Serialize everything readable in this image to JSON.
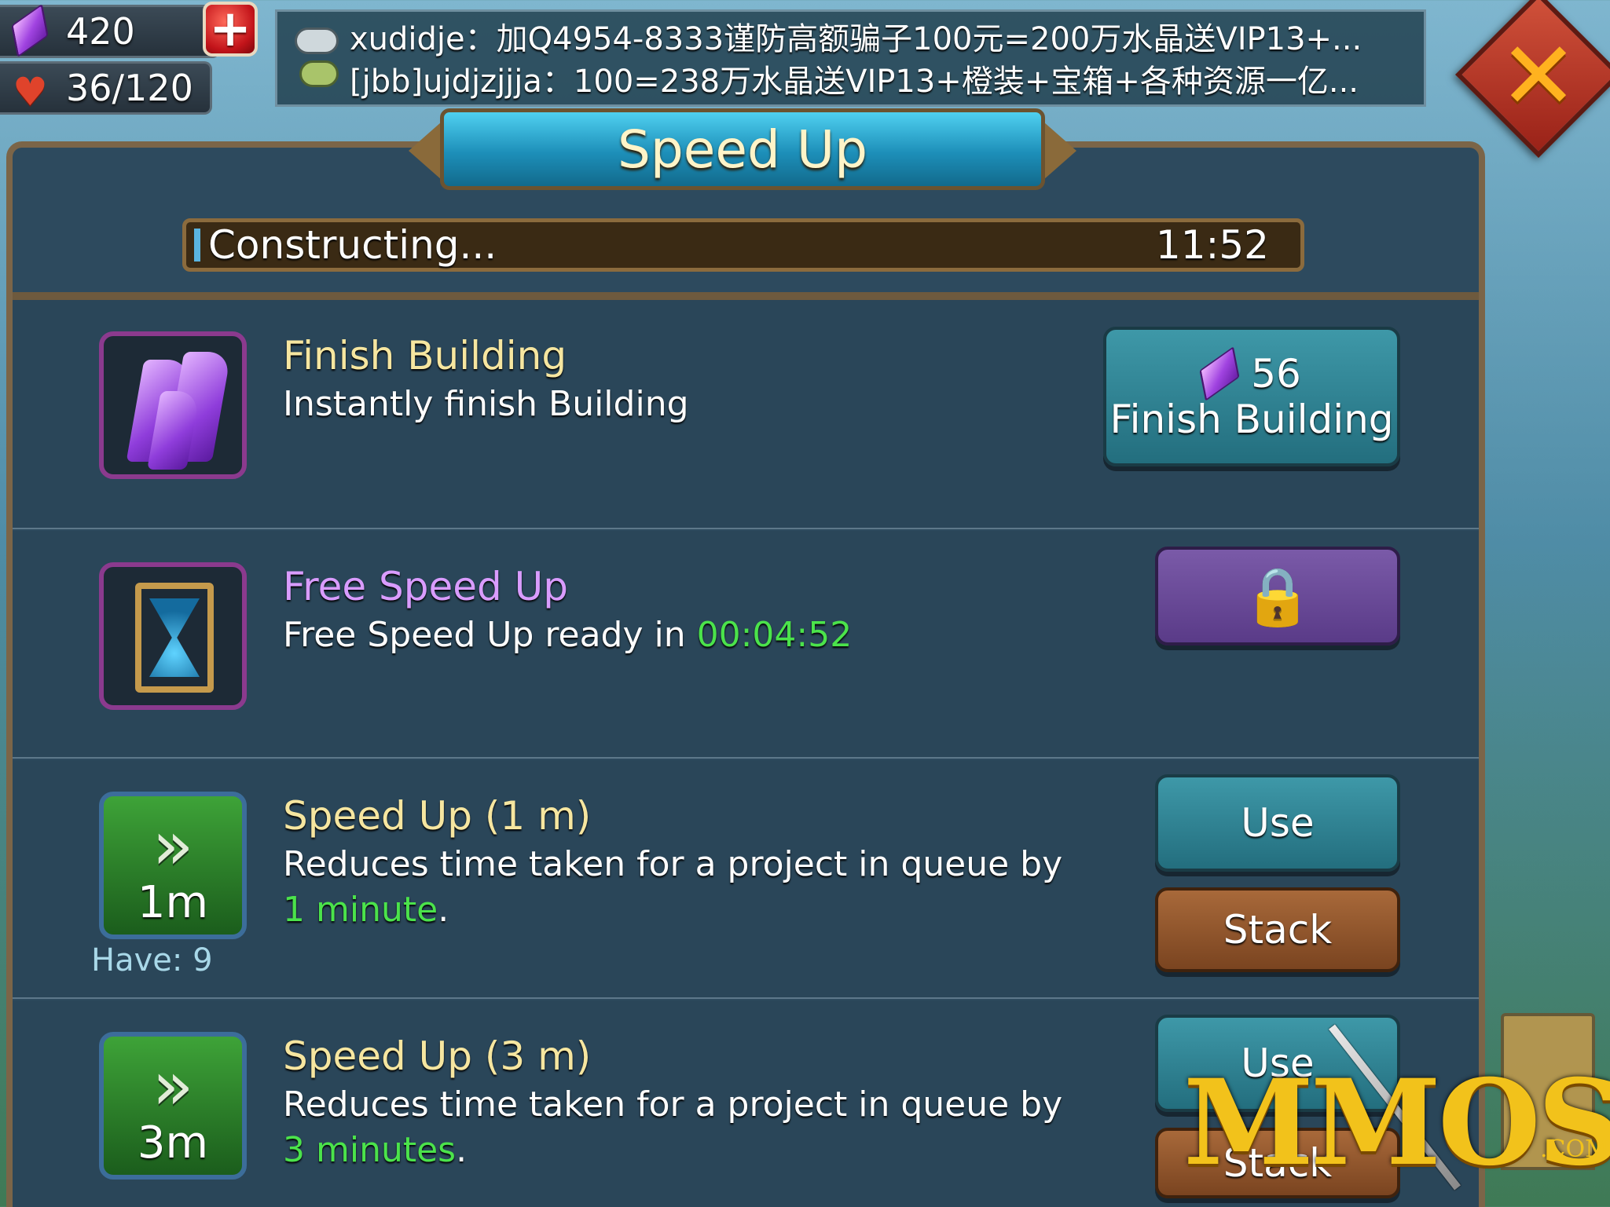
{
  "hud": {
    "gems": "420",
    "hearts": "36/120",
    "plus_symbol": "+"
  },
  "chat": {
    "line1": "xudidje：加Q4954-8333谨防高额骗子100元=200万水晶送VIP13+...",
    "line2": "[jbb]ujdjzjjja：100=238万水晶送VIP13+橙装+宝箱+各种资源一亿..."
  },
  "close_symbol": "✕",
  "title": "Speed Up",
  "progress": {
    "label": "Constructing...",
    "time": "11:52",
    "fraction": 0.01
  },
  "rows": {
    "finish": {
      "title": "Finish Building",
      "description": "Instantly finish Building",
      "price": "56",
      "button_label": "Finish Building"
    },
    "free": {
      "title": "Free Speed Up",
      "description_prefix": "Free Speed Up ready in ",
      "timer": "00:04:52",
      "button_icon": "lock-icon"
    },
    "speed_1m": {
      "title": "Speed Up (1 m)",
      "description_prefix": "Reduces time taken for a project in queue by ",
      "amount": "1",
      "unit": "minute",
      "suffix": ".",
      "icon_label": "1m",
      "have": "Have: 9",
      "use_label": "Use",
      "stack_label": "Stack"
    },
    "speed_3m": {
      "title": "Speed Up (3 m)",
      "description_prefix": "Reduces time taken for a project in queue by ",
      "amount": "3",
      "unit": "minutes",
      "suffix": ".",
      "icon_label": "3m",
      "use_label": "Use",
      "stack_label": "Stack"
    }
  },
  "watermark": {
    "text": "MMOS",
    "suffix": ".COM"
  },
  "colors": {
    "highlight_green": "#4be34b",
    "title_gold": "#f6e6a0",
    "free_title_purple": "#d99cff",
    "panel_bg": "#2d4a5e"
  }
}
